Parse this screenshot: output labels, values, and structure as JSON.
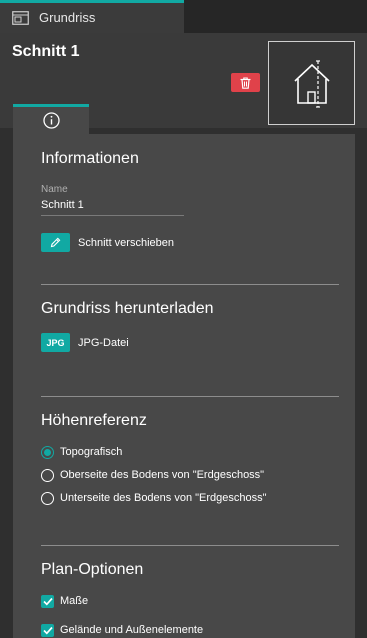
{
  "window": {
    "tab_title": "Grundriss",
    "tab_icon": "floorplan-window-icon"
  },
  "header": {
    "section_title": "Schnitt 1",
    "delete_icon": "trash-icon",
    "thumbnail_icon": "house-section-icon"
  },
  "tabs": [
    {
      "icon": "info-icon",
      "active": true
    }
  ],
  "informationen": {
    "heading": "Informationen",
    "name_label": "Name",
    "name_value": "Schnitt 1",
    "move_icon": "pencil-icon",
    "move_label": "Schnitt verschieben"
  },
  "download": {
    "heading": "Grundriss herunterladen",
    "jpg_badge": "JPG",
    "jpg_label": "JPG-Datei"
  },
  "hoehenreferenz": {
    "heading": "Höhenreferenz",
    "options": [
      {
        "label": "Topografisch",
        "selected": true
      },
      {
        "label": "Oberseite des Bodens von \"Erdgeschoss\"",
        "selected": false
      },
      {
        "label": "Unterseite des Bodens von \"Erdgeschoss\"",
        "selected": false
      }
    ]
  },
  "plan_optionen": {
    "heading": "Plan-Optionen",
    "options": [
      {
        "label": "Maße",
        "checked": true
      },
      {
        "label": "Gelände und Außenelemente",
        "checked": true
      }
    ]
  },
  "colors": {
    "accent": "#11a9a3",
    "danger": "#e0424a",
    "panel": "#484848",
    "background": "#2f2f2f"
  }
}
